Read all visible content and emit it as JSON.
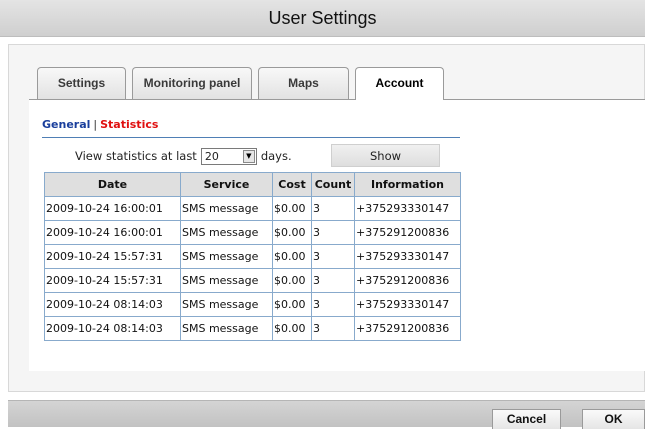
{
  "window": {
    "title": "User Settings"
  },
  "tabs": [
    {
      "label": "Settings"
    },
    {
      "label": "Monitoring panel"
    },
    {
      "label": "Maps"
    },
    {
      "label": "Account"
    }
  ],
  "subnav": {
    "general": "General",
    "separator": "|",
    "statistics": "Statistics"
  },
  "filter": {
    "prefix": "View statistics at last",
    "days_value": "20",
    "suffix": "days.",
    "show_label": "Show"
  },
  "table": {
    "headers": [
      "Date",
      "Service",
      "Cost",
      "Count",
      "Information"
    ],
    "rows": [
      [
        "2009-10-24 16:00:01",
        "SMS message",
        "$0.00",
        "3",
        "+375293330147"
      ],
      [
        "2009-10-24 16:00:01",
        "SMS message",
        "$0.00",
        "3",
        "+375291200836"
      ],
      [
        "2009-10-24 15:57:31",
        "SMS message",
        "$0.00",
        "3",
        "+375293330147"
      ],
      [
        "2009-10-24 15:57:31",
        "SMS message",
        "$0.00",
        "3",
        "+375291200836"
      ],
      [
        "2009-10-24 08:14:03",
        "SMS message",
        "$0.00",
        "3",
        "+375293330147"
      ],
      [
        "2009-10-24 08:14:03",
        "SMS message",
        "$0.00",
        "3",
        "+375291200836"
      ]
    ]
  },
  "footer": {
    "cancel_label": "Cancel",
    "ok_label": "OK"
  },
  "colors": {
    "link_general": "#1a3f9c",
    "link_statistics": "#e01010",
    "table_border": "#88aacc"
  }
}
